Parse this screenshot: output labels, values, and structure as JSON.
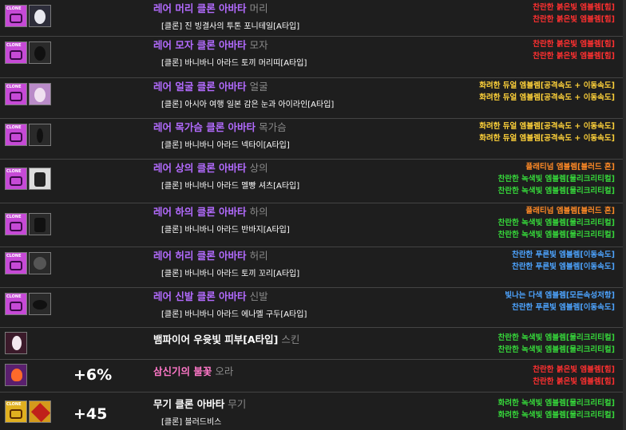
{
  "rows": [
    {
      "title": "레어 머리 클론 아바타",
      "slot": "머리",
      "sub": "[클론] 진 빙결사의 투톤 포니테일[A타입]",
      "emblems": [
        {
          "text": "찬란한 붉은빛 엠블렘[힘]",
          "color": "red"
        },
        {
          "text": "찬란한 붉은빛 엠블렘[힘]",
          "color": "red"
        }
      ]
    },
    {
      "title": "레어 모자 클론 아바타",
      "slot": "모자",
      "sub": "[클론] 바니바니 아라드 토끼 머리띠[A타입]",
      "emblems": [
        {
          "text": "찬란한 붉은빛 엠블렘[힘]",
          "color": "red"
        },
        {
          "text": "찬란한 붉은빛 엠블렘[힘]",
          "color": "red"
        }
      ]
    },
    {
      "title": "레어 얼굴 클론 아바타",
      "slot": "얼굴",
      "sub": "[클론] 아시아 여행 일본 감은 눈과 아이라인[A타입]",
      "emblems": [
        {
          "text": "화려한 듀얼 엠블렘[공격속도 + 이동속도]",
          "color": "yellow"
        },
        {
          "text": "화려한 듀얼 엠블렘[공격속도 + 이동속도]",
          "color": "yellow"
        }
      ]
    },
    {
      "title": "레어 목가슴 클론 아바타",
      "slot": "목가슴",
      "sub": "[클론] 바니바니 아라드 넥타이[A타입]",
      "emblems": [
        {
          "text": "화려한 듀얼 엠블렘[공격속도 + 이동속도]",
          "color": "yellow"
        },
        {
          "text": "화려한 듀얼 엠블렘[공격속도 + 이동속도]",
          "color": "yellow"
        }
      ]
    },
    {
      "title": "레어 상의 클론 아바타",
      "slot": "상의",
      "sub": "[클론] 바니바니 아라드 멜빵 셔츠[A타입]",
      "emblems": [
        {
          "text": "플래티넘 엠블렘[블러드 혼]",
          "color": "orange"
        },
        {
          "text": "찬란한 녹색빛 엠블렘[물리크리티컬]",
          "color": "green"
        },
        {
          "text": "찬란한 녹색빛 엠블렘[물리크리티컬]",
          "color": "green"
        }
      ]
    },
    {
      "title": "레어 하의 클론 아바타",
      "slot": "하의",
      "sub": "[클론] 바니바니 아라드 반바지[A타입]",
      "emblems": [
        {
          "text": "플래티넘 엠블렘[블러드 혼]",
          "color": "orange"
        },
        {
          "text": "찬란한 녹색빛 엠블렘[물리크리티컬]",
          "color": "green"
        },
        {
          "text": "찬란한 녹색빛 엠블렘[물리크리티컬]",
          "color": "green"
        }
      ]
    },
    {
      "title": "레어 허리 클론 아바타",
      "slot": "허리",
      "sub": "[클론] 바니바니 아라드 토끼 꼬리[A타입]",
      "emblems": [
        {
          "text": "찬란한 푸른빛 엠블렘[이동속도]",
          "color": "blue"
        },
        {
          "text": "찬란한 푸른빛 엠블렘[이동속도]",
          "color": "blue"
        }
      ]
    },
    {
      "title": "레어 신발 클론 아바타",
      "slot": "신발",
      "sub": "[클론] 바니바니 아라드 에나멜 구두[A타입]",
      "emblems": [
        {
          "text": "빛나는 다색 엠블렘[모든속성저항]",
          "color": "blue"
        },
        {
          "text": "찬란한 푸른빛 엠블렘[이동속도]",
          "color": "blue"
        }
      ]
    },
    {
      "title": "뱀파이어 우윳빛 피부[A타입]",
      "slot": "스킨",
      "sub": "",
      "emblems": [
        {
          "text": "찬란한 녹색빛 엠블렘[물리크리티컬]",
          "color": "green"
        },
        {
          "text": "찬란한 녹색빛 엠블렘[물리크리티컬]",
          "color": "green"
        }
      ]
    },
    {
      "title": "삼신기의 불꽃",
      "slot": "오라",
      "sub": "",
      "bonus": "+6%",
      "emblems": [
        {
          "text": "찬란한 붉은빛 엠블렘[힘]",
          "color": "red"
        },
        {
          "text": "찬란한 붉은빛 엠블렘[힘]",
          "color": "red"
        }
      ]
    },
    {
      "title": "무기 클론 아바타",
      "slot": "무기",
      "sub": "[클론] 블러드비스",
      "bonus": "+45",
      "emblems": [
        {
          "text": "화려한 녹색빛 엠블렘[물리크리티컬]",
          "color": "green"
        },
        {
          "text": "화려한 녹색빛 엠블렘[물리크리티컬]",
          "color": "green"
        }
      ]
    }
  ]
}
